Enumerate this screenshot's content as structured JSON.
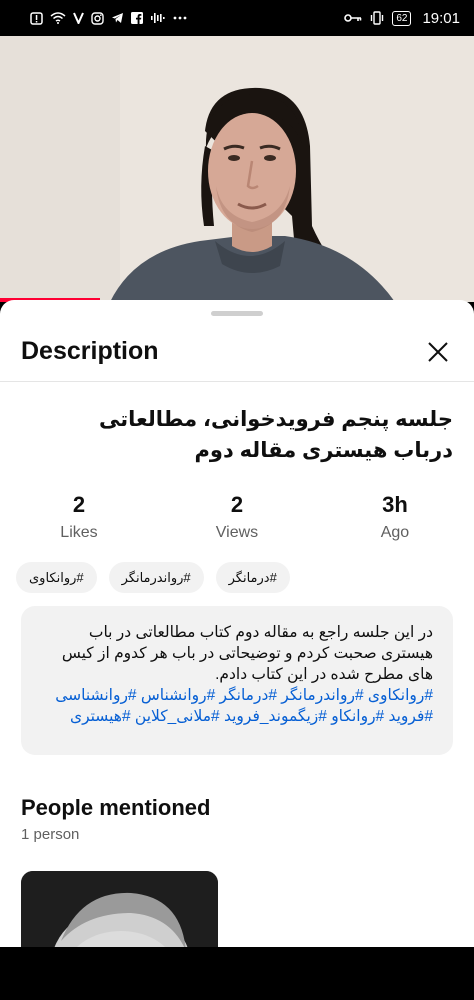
{
  "status_bar": {
    "time": "19:01",
    "battery": "62",
    "left_icons": [
      "alert-icon",
      "wifi-icon",
      "v-icon",
      "instagram-icon",
      "telegram-icon",
      "facebook-icon",
      "audio-icon",
      "more-icon"
    ],
    "right_icons": [
      "key-icon",
      "vibrate-icon",
      "battery-icon"
    ]
  },
  "video": {
    "progress_fraction": 0.21
  },
  "sheet": {
    "title": "Description",
    "close_icon": "close-icon"
  },
  "video_title": "جلسه پنجم فرویدخوانی، مطالعاتی درباب هیستری مقاله دوم",
  "stats": [
    {
      "value": "2",
      "label": "Likes"
    },
    {
      "value": "2",
      "label": "Views"
    },
    {
      "value": "3h",
      "label": "Ago"
    }
  ],
  "tags": [
    "#روانکاوی",
    "#رواندرمانگر",
    "#درمانگر"
  ],
  "description": {
    "text": "در این جلسه راجع به مقاله دوم کتاب مطالعاتی در باب هیستری صحبت کردم و توضیحاتی در باب هر کدوم از کیس های مطرح شده در این کتاب دادم.",
    "hashtags": "#روانکاوی #رواندرمانگر #درمانگر #روانشناس #روانشناسی #فروید #روانکاو #زیگموند_فروید #ملانی_کلاین #هیستری"
  },
  "people": {
    "title": "People mentioned",
    "count": "1 person"
  },
  "colors": {
    "accent": "#ff0033",
    "link": "#065fd4",
    "muted": "#606060",
    "chip_bg": "#f2f2f2"
  }
}
